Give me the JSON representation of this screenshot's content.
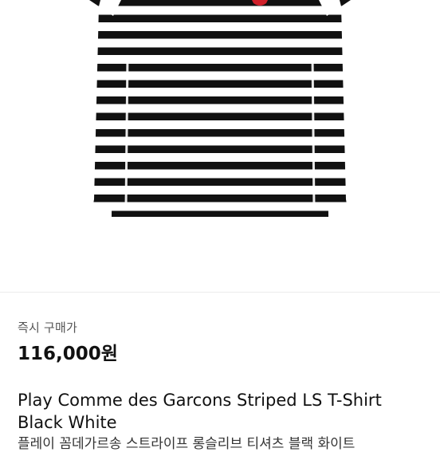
{
  "product": {
    "image_alt": "black and white striped long-sleeve t-shirt",
    "stripe_colors": {
      "dark": "#111111",
      "light": "#ffffff",
      "heart": "#d0202a"
    }
  },
  "purchase": {
    "label": "즉시 구매가",
    "price": "116,000원"
  },
  "listing": {
    "title_line1": "Play Comme des Garcons Striped LS T-Shirt",
    "title_line2": "Black White",
    "subtitle": "플레이 꼼데가르송 스트라이프 롱슬리브 티셔츠 블랙 화이트"
  }
}
